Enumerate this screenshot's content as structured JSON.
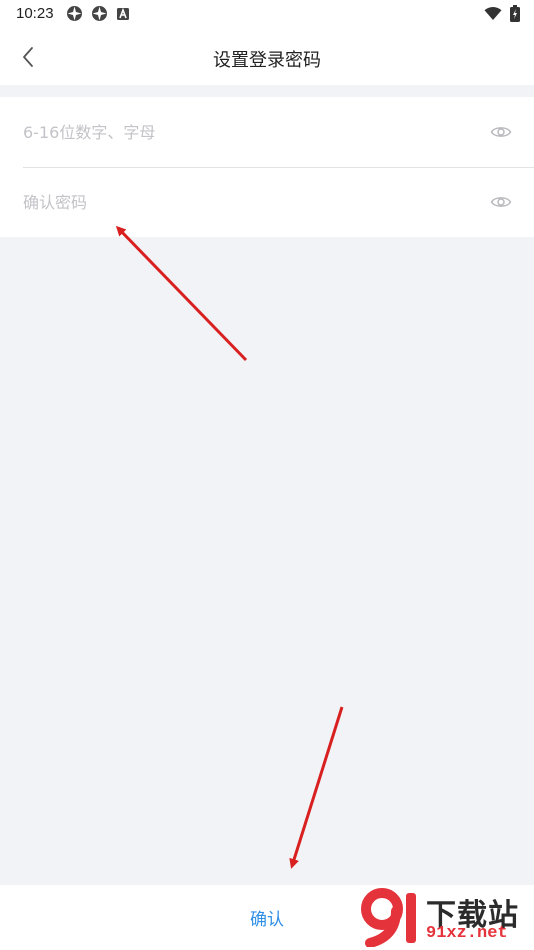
{
  "status_bar": {
    "time": "10:23",
    "left_icons": [
      "app-icon",
      "app-icon",
      "notification-icon"
    ],
    "right_icons": [
      "wifi-icon",
      "battery-icon"
    ]
  },
  "header": {
    "title": "设置登录密码",
    "back_icon": "chevron-left-icon"
  },
  "form": {
    "password": {
      "value": "",
      "placeholder": "6-16位数字、字母",
      "toggle_icon": "eye-icon"
    },
    "confirm_password": {
      "value": "",
      "placeholder": "确认密码",
      "toggle_icon": "eye-icon"
    }
  },
  "footer": {
    "confirm_label": "确认"
  },
  "watermark": {
    "top_text": "下载站",
    "bottom_text": "91xz.net"
  },
  "colors": {
    "accent": "#2f8fe6",
    "background": "#f2f3f7",
    "annotation_arrow": "#d92020",
    "watermark_red": "#e5333b"
  }
}
